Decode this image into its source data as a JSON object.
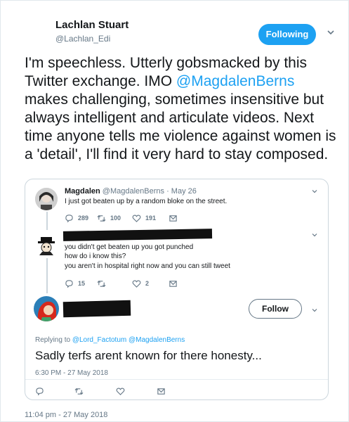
{
  "tweet": {
    "author_name": "Lachlan Stuart",
    "author_handle": "@Lachlan_Edi",
    "follow_state_label": "Following",
    "text_before": "I'm speechless. Utterly gobsmacked by this Twitter exchange. IMO ",
    "mention": "@MagdalenBerns",
    "text_after": " makes challenging, sometimes insensitive but always intelligent and articulate videos. Next time anyone tells me violence against women is a 'detail', I'll find it very hard to stay composed.",
    "timestamp": "11:04 pm - 27 May 2018"
  },
  "quote": {
    "first": {
      "name": "Magdalen",
      "handle": "@MagdalenBerns",
      "date": "· May 26",
      "text": "I just got beaten up by a random bloke on the street.",
      "replies": "289",
      "retweets": "100",
      "likes": "191"
    },
    "second": {
      "lines": [
        "you didn't get beaten up you got punched",
        "how do i know this?",
        "you aren't in hospital right now and you can still tweet"
      ],
      "replies": "15",
      "retweets": "",
      "likes": "2"
    },
    "third": {
      "follow_label": "Follow",
      "replying_prefix": "Replying to",
      "replying_handles": "@Lord_Factotum @MagdalenBerns",
      "text": "Sadly terfs arent known for there honesty...",
      "timestamp": "6:30 PM - 27 May 2018"
    }
  },
  "colors": {
    "accent": "#1da1f2",
    "muted": "#657786",
    "border": "#ccd6dd"
  },
  "icons": [
    "chevron-down-icon",
    "reply-icon",
    "retweet-icon",
    "like-icon",
    "message-icon"
  ]
}
